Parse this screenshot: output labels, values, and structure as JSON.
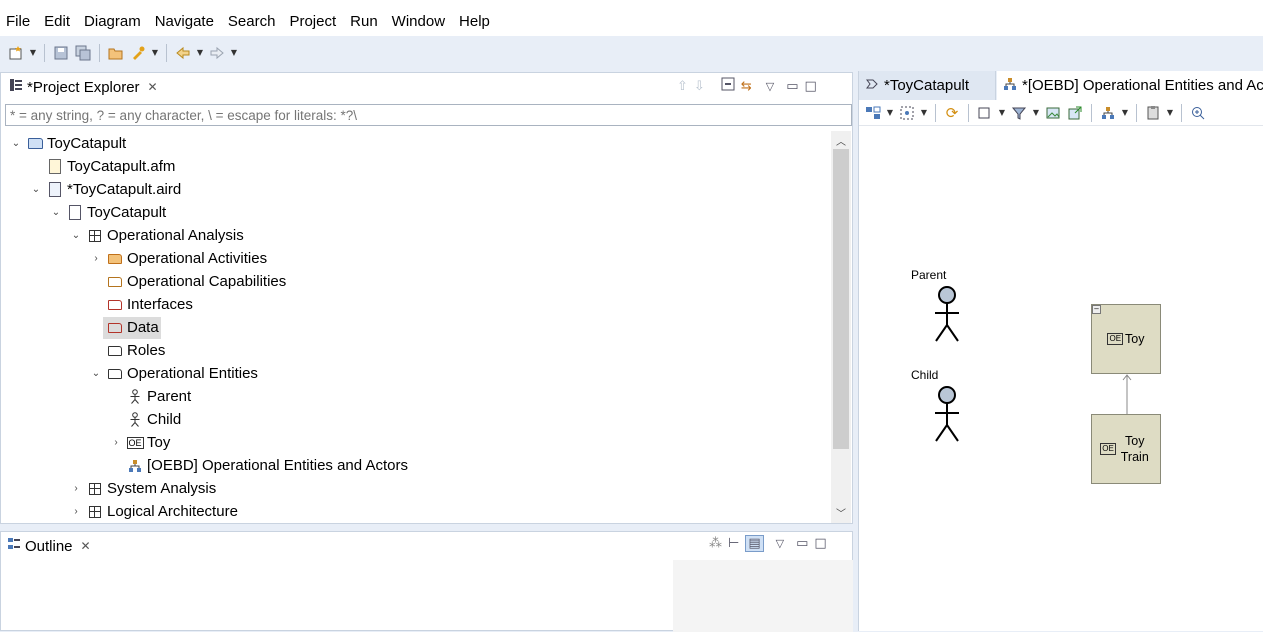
{
  "menu": [
    "File",
    "Edit",
    "Diagram",
    "Navigate",
    "Search",
    "Project",
    "Run",
    "Window",
    "Help"
  ],
  "project_explorer": {
    "tab_title": "*Project Explorer",
    "filter_placeholder": "* = any string, ? = any character, \\ = escape for literals: *?\\",
    "tree": [
      {
        "label": "ToyCatapult",
        "icon": "project-folder-icon",
        "twist": "expanded"
      },
      {
        "label": "ToyCatapult.afm",
        "icon": "afm-file-icon",
        "twist": "none"
      },
      {
        "label": "*ToyCatapult.aird",
        "icon": "aird-file-icon",
        "twist": "expanded"
      },
      {
        "label": "ToyCatapult",
        "icon": "model-icon",
        "twist": "expanded"
      },
      {
        "label": "Operational Analysis",
        "icon": "grid-icon",
        "twist": "expanded"
      },
      {
        "label": "Operational Activities",
        "icon": "orange-folder-icon",
        "twist": "collapsed"
      },
      {
        "label": "Operational Capabilities",
        "icon": "orange-folder-icon",
        "twist": "none"
      },
      {
        "label": "Interfaces",
        "icon": "red-folder-icon",
        "twist": "none"
      },
      {
        "label": "Data",
        "icon": "red-folder-icon",
        "twist": "none"
      },
      {
        "label": "Roles",
        "icon": "folder-icon",
        "twist": "none"
      },
      {
        "label": "Operational Entities",
        "icon": "folder-icon",
        "twist": "expanded"
      },
      {
        "label": "Parent",
        "icon": "actor-icon",
        "twist": "none"
      },
      {
        "label": "Child",
        "icon": "actor-icon",
        "twist": "none"
      },
      {
        "label": "Toy",
        "icon": "entity-icon",
        "twist": "collapsed"
      },
      {
        "label": "[OEBD] Operational Entities and Actors",
        "icon": "diagram-icon",
        "twist": "none"
      },
      {
        "label": "System Analysis",
        "icon": "grid-icon",
        "twist": "collapsed"
      },
      {
        "label": "Logical Architecture",
        "icon": "grid-icon",
        "twist": "collapsed"
      }
    ],
    "selected_index": 8
  },
  "outline": {
    "tab_title": "Outline"
  },
  "editor": {
    "tabs": [
      "*ToyCatapult",
      "*[OEBD] Operational Entities and Act"
    ],
    "actors": [
      "Parent",
      "Child"
    ],
    "entities": [
      "Toy",
      "Toy Train"
    ],
    "entity_badge": "OE"
  }
}
